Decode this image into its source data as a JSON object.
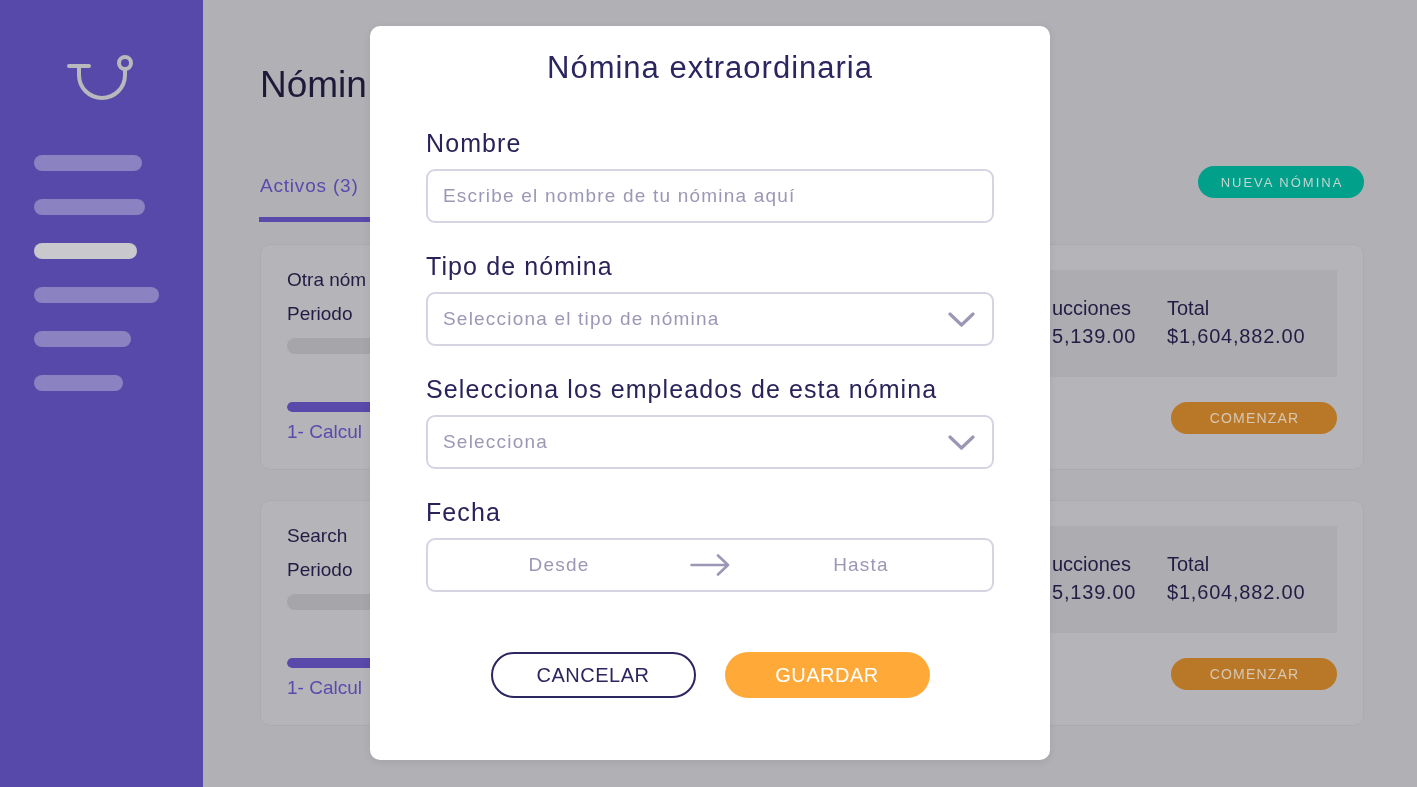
{
  "sidebar": {
    "items": [
      {
        "selected": false
      },
      {
        "selected": false
      },
      {
        "selected": true
      },
      {
        "selected": false
      },
      {
        "selected": false
      },
      {
        "selected": false
      }
    ]
  },
  "header": {
    "title": "Nómin",
    "new_button": "NUEVA NÓMINA"
  },
  "tabs": [
    {
      "label": "Activos (3)",
      "selected": true
    }
  ],
  "payrolls": [
    {
      "title": "Otra nóm",
      "period": "Periodo",
      "progress": {
        "level": 1
      },
      "step": "1- Calcul",
      "summary": [
        {
          "label": "ucciones",
          "value": "5,139.00"
        },
        {
          "label": "Total",
          "value": "$1,604,882.00"
        }
      ],
      "button": "COMENZAR"
    },
    {
      "title": "Search",
      "period": "Periodo",
      "progress": {
        "level": 1
      },
      "step": "1- Calcul",
      "summary": [
        {
          "label": "ucciones",
          "value": "5,139.00"
        },
        {
          "label": "Total",
          "value": "$1,604,882.00"
        }
      ],
      "button": "COMENZAR"
    }
  ],
  "dialog": {
    "title": "Nómina extraordinaria",
    "fields": [
      {
        "kind": "text",
        "label": "Nombre",
        "placeholder": "Escribe el nombre de tu nómina aquí"
      },
      {
        "kind": "select",
        "label": "Tipo de nómina",
        "placeholder": "Selecciona el tipo de nómina"
      },
      {
        "kind": "select",
        "label": "Selecciona los empleados de esta nómina",
        "placeholder": "Selecciona"
      },
      {
        "kind": "date_range",
        "label": "Fecha",
        "start": {
          "placeholder": "Desde"
        },
        "end": {
          "placeholder": "Hasta"
        }
      }
    ],
    "buttons": [
      {
        "kind": "secondary",
        "label": "CANCELAR"
      },
      {
        "kind": "primary",
        "label": "GUARDAR"
      }
    ]
  }
}
